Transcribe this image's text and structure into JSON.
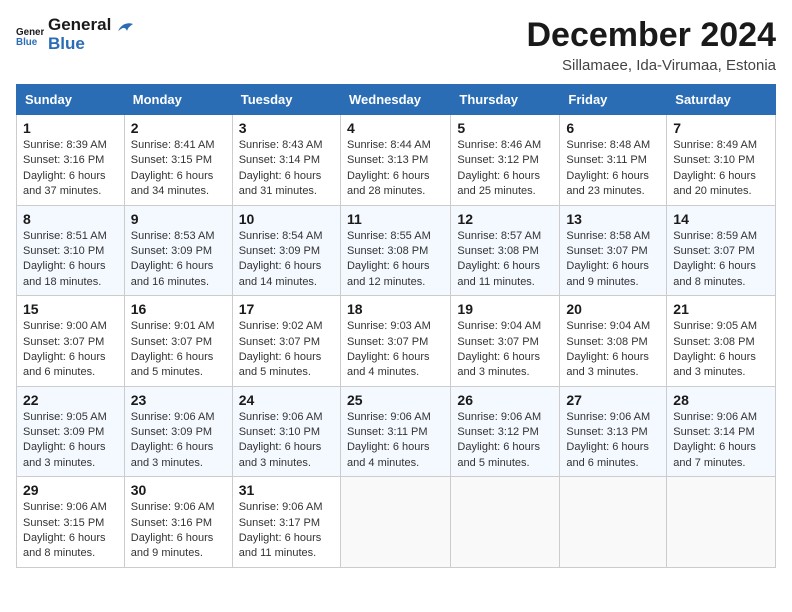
{
  "logo": {
    "line1": "General",
    "line2": "Blue"
  },
  "title": "December 2024",
  "subtitle": "Sillamaee, Ida-Virumaa, Estonia",
  "weekdays": [
    "Sunday",
    "Monday",
    "Tuesday",
    "Wednesday",
    "Thursday",
    "Friday",
    "Saturday"
  ],
  "weeks": [
    [
      {
        "day": "1",
        "sunrise": "8:39 AM",
        "sunset": "3:16 PM",
        "daylight": "6 hours and 37 minutes."
      },
      {
        "day": "2",
        "sunrise": "8:41 AM",
        "sunset": "3:15 PM",
        "daylight": "6 hours and 34 minutes."
      },
      {
        "day": "3",
        "sunrise": "8:43 AM",
        "sunset": "3:14 PM",
        "daylight": "6 hours and 31 minutes."
      },
      {
        "day": "4",
        "sunrise": "8:44 AM",
        "sunset": "3:13 PM",
        "daylight": "6 hours and 28 minutes."
      },
      {
        "day": "5",
        "sunrise": "8:46 AM",
        "sunset": "3:12 PM",
        "daylight": "6 hours and 25 minutes."
      },
      {
        "day": "6",
        "sunrise": "8:48 AM",
        "sunset": "3:11 PM",
        "daylight": "6 hours and 23 minutes."
      },
      {
        "day": "7",
        "sunrise": "8:49 AM",
        "sunset": "3:10 PM",
        "daylight": "6 hours and 20 minutes."
      }
    ],
    [
      {
        "day": "8",
        "sunrise": "8:51 AM",
        "sunset": "3:10 PM",
        "daylight": "6 hours and 18 minutes."
      },
      {
        "day": "9",
        "sunrise": "8:53 AM",
        "sunset": "3:09 PM",
        "daylight": "6 hours and 16 minutes."
      },
      {
        "day": "10",
        "sunrise": "8:54 AM",
        "sunset": "3:09 PM",
        "daylight": "6 hours and 14 minutes."
      },
      {
        "day": "11",
        "sunrise": "8:55 AM",
        "sunset": "3:08 PM",
        "daylight": "6 hours and 12 minutes."
      },
      {
        "day": "12",
        "sunrise": "8:57 AM",
        "sunset": "3:08 PM",
        "daylight": "6 hours and 11 minutes."
      },
      {
        "day": "13",
        "sunrise": "8:58 AM",
        "sunset": "3:07 PM",
        "daylight": "6 hours and 9 minutes."
      },
      {
        "day": "14",
        "sunrise": "8:59 AM",
        "sunset": "3:07 PM",
        "daylight": "6 hours and 8 minutes."
      }
    ],
    [
      {
        "day": "15",
        "sunrise": "9:00 AM",
        "sunset": "3:07 PM",
        "daylight": "6 hours and 6 minutes."
      },
      {
        "day": "16",
        "sunrise": "9:01 AM",
        "sunset": "3:07 PM",
        "daylight": "6 hours and 5 minutes."
      },
      {
        "day": "17",
        "sunrise": "9:02 AM",
        "sunset": "3:07 PM",
        "daylight": "6 hours and 5 minutes."
      },
      {
        "day": "18",
        "sunrise": "9:03 AM",
        "sunset": "3:07 PM",
        "daylight": "6 hours and 4 minutes."
      },
      {
        "day": "19",
        "sunrise": "9:04 AM",
        "sunset": "3:07 PM",
        "daylight": "6 hours and 3 minutes."
      },
      {
        "day": "20",
        "sunrise": "9:04 AM",
        "sunset": "3:08 PM",
        "daylight": "6 hours and 3 minutes."
      },
      {
        "day": "21",
        "sunrise": "9:05 AM",
        "sunset": "3:08 PM",
        "daylight": "6 hours and 3 minutes."
      }
    ],
    [
      {
        "day": "22",
        "sunrise": "9:05 AM",
        "sunset": "3:09 PM",
        "daylight": "6 hours and 3 minutes."
      },
      {
        "day": "23",
        "sunrise": "9:06 AM",
        "sunset": "3:09 PM",
        "daylight": "6 hours and 3 minutes."
      },
      {
        "day": "24",
        "sunrise": "9:06 AM",
        "sunset": "3:10 PM",
        "daylight": "6 hours and 3 minutes."
      },
      {
        "day": "25",
        "sunrise": "9:06 AM",
        "sunset": "3:11 PM",
        "daylight": "6 hours and 4 minutes."
      },
      {
        "day": "26",
        "sunrise": "9:06 AM",
        "sunset": "3:12 PM",
        "daylight": "6 hours and 5 minutes."
      },
      {
        "day": "27",
        "sunrise": "9:06 AM",
        "sunset": "3:13 PM",
        "daylight": "6 hours and 6 minutes."
      },
      {
        "day": "28",
        "sunrise": "9:06 AM",
        "sunset": "3:14 PM",
        "daylight": "6 hours and 7 minutes."
      }
    ],
    [
      {
        "day": "29",
        "sunrise": "9:06 AM",
        "sunset": "3:15 PM",
        "daylight": "6 hours and 8 minutes."
      },
      {
        "day": "30",
        "sunrise": "9:06 AM",
        "sunset": "3:16 PM",
        "daylight": "6 hours and 9 minutes."
      },
      {
        "day": "31",
        "sunrise": "9:06 AM",
        "sunset": "3:17 PM",
        "daylight": "6 hours and 11 minutes."
      },
      null,
      null,
      null,
      null
    ]
  ]
}
